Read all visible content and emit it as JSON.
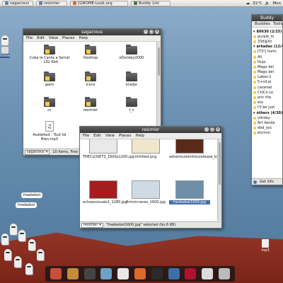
{
  "panel": {
    "tasks": [
      {
        "label": "sagacious"
      },
      {
        "label": "resimler"
      },
      {
        "label": "[GNOME-Look.org"
      },
      {
        "label": "Buddy List"
      }
    ],
    "weather": "31°C",
    "clock": "Mon"
  },
  "colors": {
    "desktop": "#6f94b4",
    "floor": "#8a2f22",
    "titlebar": "#4a4a4a"
  },
  "desktop_label": "home",
  "file_manager": {
    "title": "sagacious",
    "menu": [
      "File",
      "Edit",
      "View",
      "Places",
      "Help"
    ],
    "items": [
      {
        "label": "Cuba le Canta a Serrat - 192 Kbit",
        "icon": "folder-shared-icon"
      },
      {
        "label": "Desktop",
        "icon": "folder-desktop-icon"
      },
      {
        "label": "eDonkey2000",
        "icon": "folder-icon"
      },
      {
        "label": "gaim",
        "icon": "folder-gaim-icon"
      },
      {
        "label": "icons",
        "icon": "folder-icons-icon"
      },
      {
        "label": "kradyr",
        "icon": "folder-icon"
      },
      {
        "label": "cc",
        "icon": "folder-cc-icon"
      },
      {
        "label": "resimler",
        "icon": "folder-pictures-icon"
      },
      {
        "label": "t_s",
        "icon": "folder-icon"
      },
      {
        "label": "Asafatted - Tout Va Bien.mp3",
        "icon": "audio-file-icon"
      }
    ],
    "status_path": "sagacious",
    "status_text": "10 items, Free space"
  },
  "image_viewer": {
    "title": "resimler",
    "menu": [
      "File",
      "Edit",
      "View",
      "Places",
      "Help"
    ],
    "items": [
      {
        "label": "THECLOSETS_1600x1200.jpg",
        "color": "#e9e9e9"
      },
      {
        "label": "Untitled.png",
        "color": "#efe6cc"
      },
      {
        "label": "adventuresinfuturetease_by_0concept.jpg",
        "color": "#5a2a1a"
      },
      {
        "label": "echoesvisuals1_1280.jpg",
        "color": "#a51e1e"
      },
      {
        "label": "firmvicranes_1600.jpg",
        "color": "#cfdbe4"
      },
      {
        "label": "freebebot1600.jpg",
        "color": "#6f8ea8"
      }
    ],
    "status_path": "resimler",
    "status_text": "\"freebebot1600.jpg\" selected (bo.6 KB)"
  },
  "buddy_list": {
    "title": "Buddy",
    "menu": [
      "Buddies",
      "Tools"
    ],
    "rows": [
      {
        "label": "80630 (2/25)",
        "group": true
      },
      {
        "label": "purple_m",
        "group": false
      },
      {
        "label": "33d@lin",
        "group": false
      },
      {
        "label": "arkadas (12/43)",
        "group": true
      },
      {
        "label": "[Y3!] hurts",
        "group": false
      },
      {
        "label": "Ali",
        "group": false
      },
      {
        "label": "Hujo",
        "group": false
      },
      {
        "label": "Mago del",
        "group": false
      },
      {
        "label": "Mago del",
        "group": false
      },
      {
        "label": "Lobos-1",
        "group": false
      },
      {
        "label": "5+cd pi",
        "group": false
      },
      {
        "label": "caramel",
        "group": false
      },
      {
        "label": "ChiCo Lo",
        "group": false
      },
      {
        "label": "eric the",
        "group": false
      },
      {
        "label": "esc",
        "group": false
      },
      {
        "label": "I'll be just",
        "group": false
      },
      {
        "label": "others (4/30)",
        "group": true
      },
      {
        "label": "vikiday",
        "group": false
      },
      {
        "label": "Art Vande",
        "group": false
      },
      {
        "label": "ebd_osc",
        "group": false
      },
      {
        "label": "elcinnn",
        "group": false
      }
    ],
    "status": "Get info"
  },
  "desktop_file": {
    "label": "mp3"
  },
  "speech_bubbles": [
    "freebebot",
    "freebebot"
  ],
  "dock": [
    {
      "icon": "rubik-cube-icon",
      "color": "#c94f3a"
    },
    {
      "icon": "sunset-app-icon",
      "color": "#c88a3a"
    },
    {
      "icon": "chat-bubble-icon",
      "color": "#444444"
    },
    {
      "icon": "network-globe-icon",
      "color": "#6fa0c8"
    },
    {
      "icon": "tux-icon",
      "color": "#e8e8e8"
    },
    {
      "icon": "firefox-icon",
      "color": "#d86a2a"
    },
    {
      "icon": "cross-tools-icon",
      "color": "#2a2a2a"
    },
    {
      "icon": "globe-icon",
      "color": "#3d6fa8"
    },
    {
      "icon": "debian-swirl-icon",
      "color": "#b0112c"
    },
    {
      "icon": "apple-icon",
      "color": "#dcdcdc"
    },
    {
      "icon": "trash-icon",
      "color": "#bbbbbb"
    }
  ]
}
